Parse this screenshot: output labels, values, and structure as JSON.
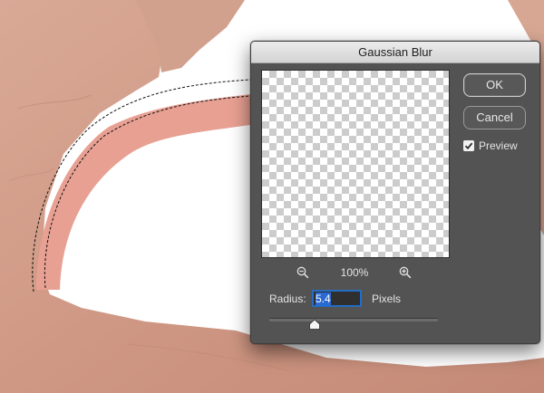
{
  "dialog": {
    "title": "Gaussian Blur",
    "ok_label": "OK",
    "cancel_label": "Cancel",
    "preview_label": "Preview",
    "preview_checked": true,
    "zoom_level": "100%",
    "zoom_out_icon": "zoom-out-icon",
    "zoom_in_icon": "zoom-in-icon",
    "radius_label": "Radius:",
    "radius_value": "5.4",
    "radius_unit": "Pixels",
    "slider_fraction": 0.27
  },
  "colors": {
    "dialog_bg": "#535353",
    "selection_highlight": "#2b6ad2",
    "skin_mask": "#e8a093"
  }
}
